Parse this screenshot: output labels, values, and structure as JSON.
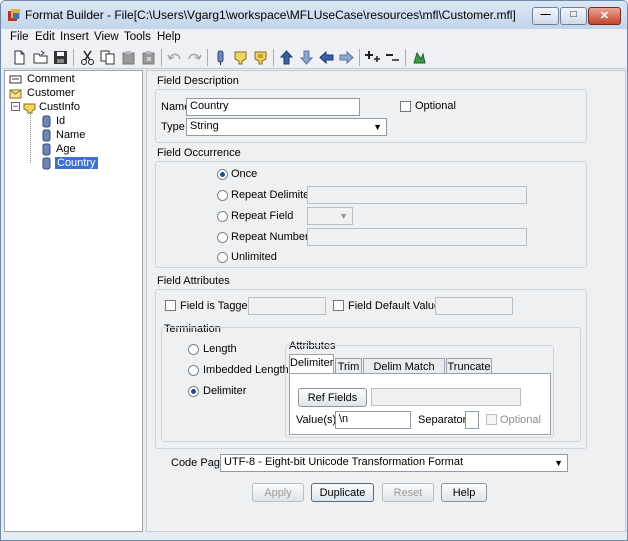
{
  "window": {
    "title": "Format Builder - File[C:\\Users\\Vgarg1\\workspace\\MFLUseCase\\resources\\mfl\\Customer.mfl]",
    "minimize_label": "—",
    "maximize_label": "□",
    "close_label": "✕"
  },
  "menu": {
    "file": "File",
    "edit": "Edit",
    "insert": "Insert",
    "view": "View",
    "tools": "Tools",
    "help": "Help"
  },
  "tree": {
    "comment": "Comment",
    "customer": "Customer",
    "custinfo": "CustInfo",
    "fields": [
      "Id",
      "Name",
      "Age",
      "Country"
    ],
    "expander": "−"
  },
  "field_description": {
    "legend": "Field Description",
    "name_label": "Name",
    "name_value": "Country",
    "optional_label": "Optional",
    "type_label": "Type",
    "type_value": "String"
  },
  "field_occurrence": {
    "legend": "Field Occurrence",
    "once": "Once",
    "repeat_delimiter": "Repeat Delimiter",
    "repeat_field": "Repeat Field",
    "repeat_number": "Repeat Number",
    "unlimited": "Unlimited",
    "selected": "Once"
  },
  "field_attributes": {
    "legend": "Field Attributes",
    "field_is_tagged": "Field is Tagged",
    "field_default_value": "Field Default Value"
  },
  "termination": {
    "legend": "Termination",
    "length": "Length",
    "imbedded_length": "Imbedded Length",
    "delimiter": "Delimiter",
    "selected": "Delimiter"
  },
  "attributes": {
    "legend": "Attributes",
    "tabs": [
      "Delimiter",
      "Trim",
      "Delim Match Rule",
      "Truncate"
    ],
    "ref_fields_label": "Ref Fields",
    "values_label": "Value(s)",
    "values_value": "\\n",
    "separator_label": "Separator",
    "optional_label": "Optional"
  },
  "code_page": {
    "label": "Code Page",
    "value": "UTF-8 - Eight-bit Unicode Transformation Format"
  },
  "buttons": {
    "apply": "Apply",
    "duplicate": "Duplicate",
    "reset": "Reset",
    "help": "Help"
  },
  "colors": {
    "title_bar": "#c3d5ea",
    "selection": "#3f6fcf",
    "close_button": "#c4442c",
    "panel_bg": "#eef0f2"
  }
}
